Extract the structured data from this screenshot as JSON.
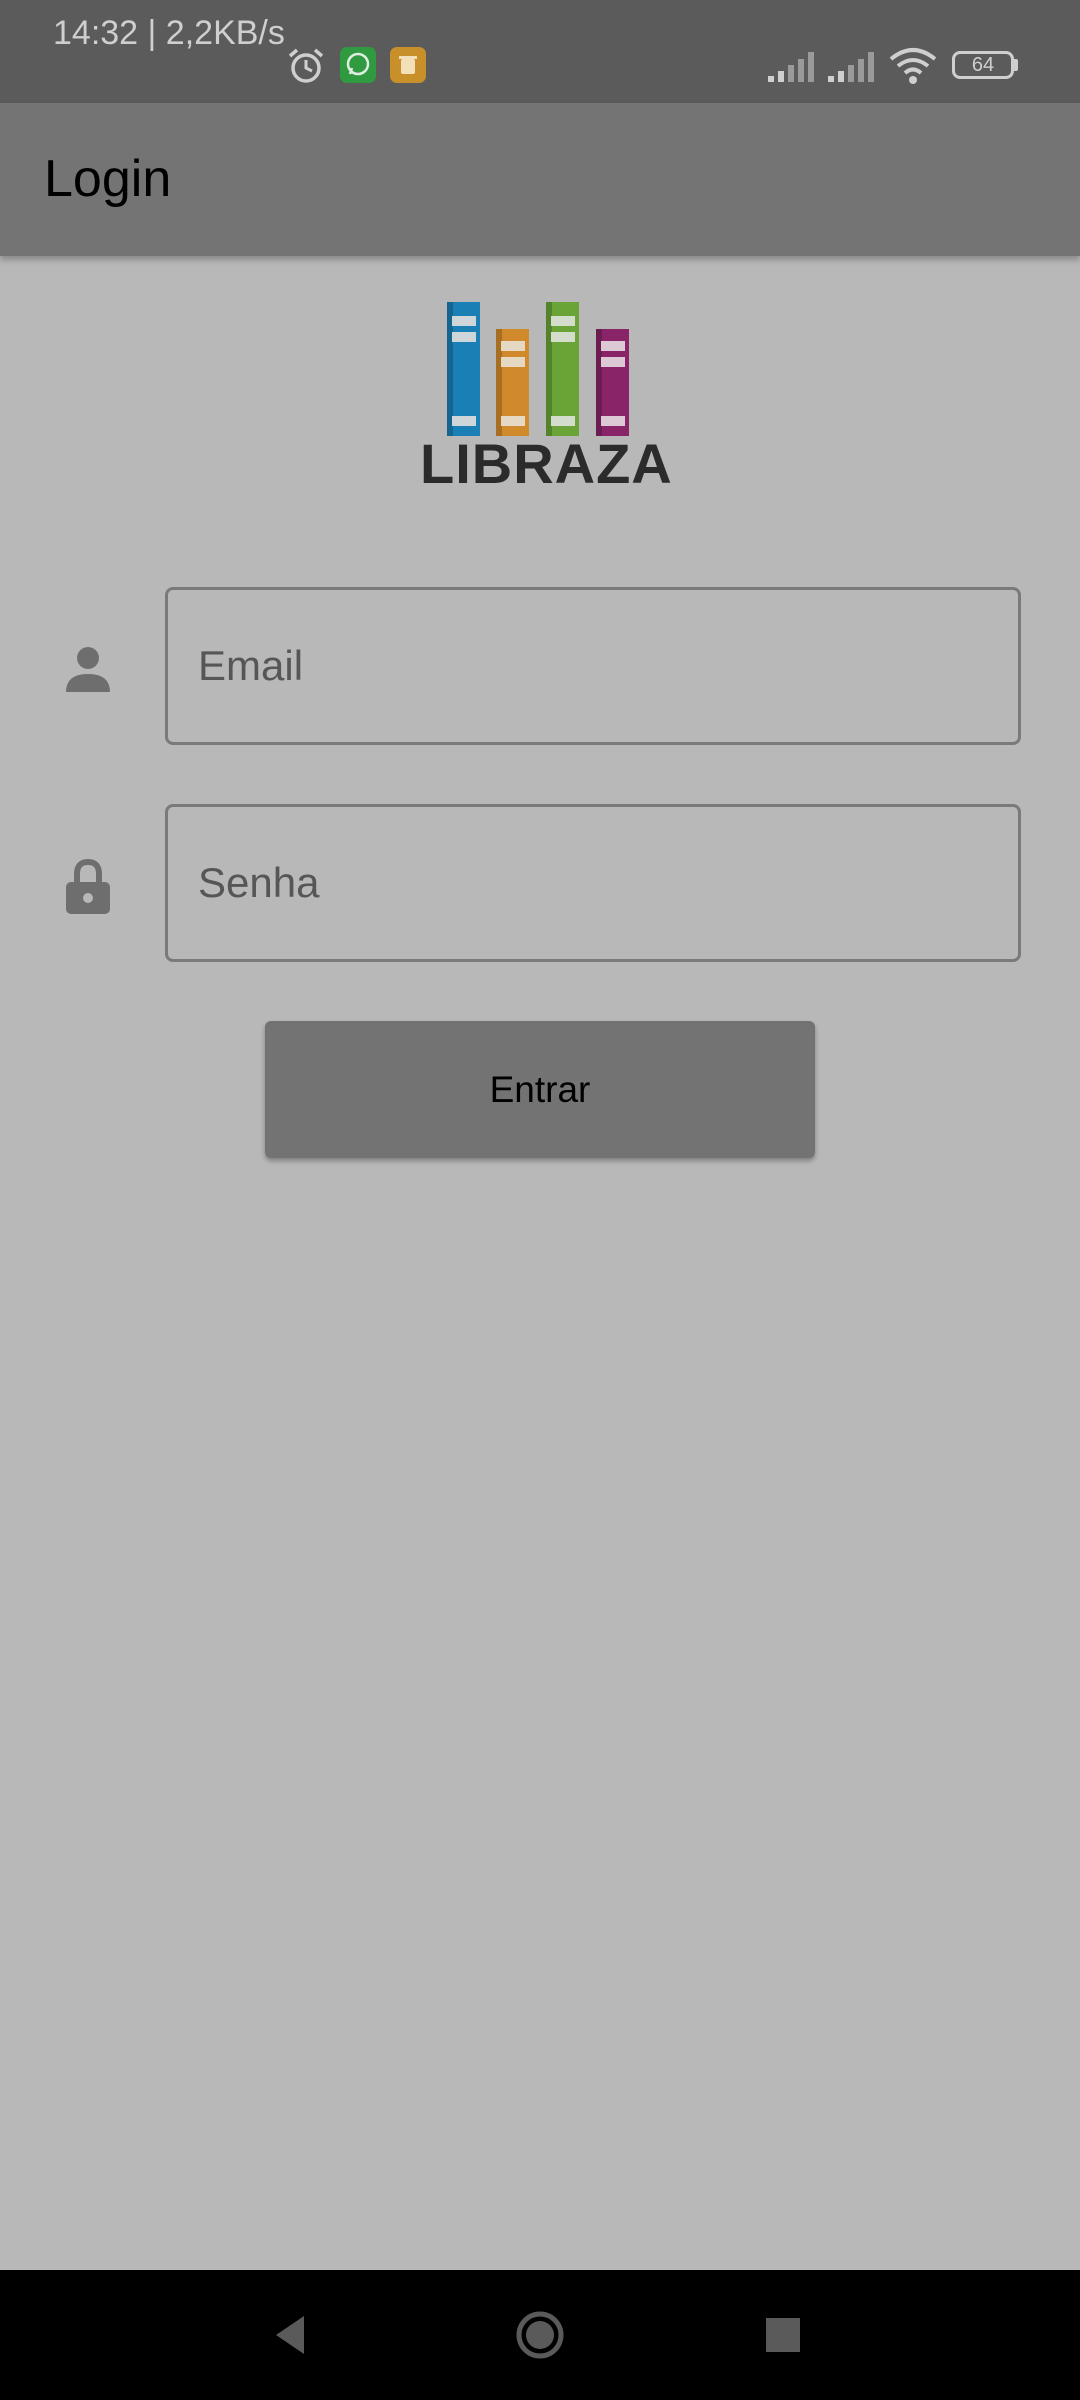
{
  "status_bar": {
    "time_speed": "14:32 | 2,2KB/s",
    "battery": "64",
    "icons": [
      "alarm-icon",
      "whatsapp-icon",
      "notification-app-icon",
      "signal-icon",
      "signal-icon",
      "wifi-icon",
      "battery-icon"
    ]
  },
  "app_bar": {
    "title": "Login"
  },
  "logo": {
    "text": "LIBRAZA",
    "book_colors": [
      "#1a7fb4",
      "#d08a2c",
      "#6aa437",
      "#8a2468"
    ]
  },
  "form": {
    "email_placeholder": "Email",
    "password_placeholder": "Senha",
    "submit_label": "Entrar"
  },
  "nav_bar": {
    "icons": [
      "back-icon",
      "home-icon",
      "recents-icon"
    ]
  }
}
